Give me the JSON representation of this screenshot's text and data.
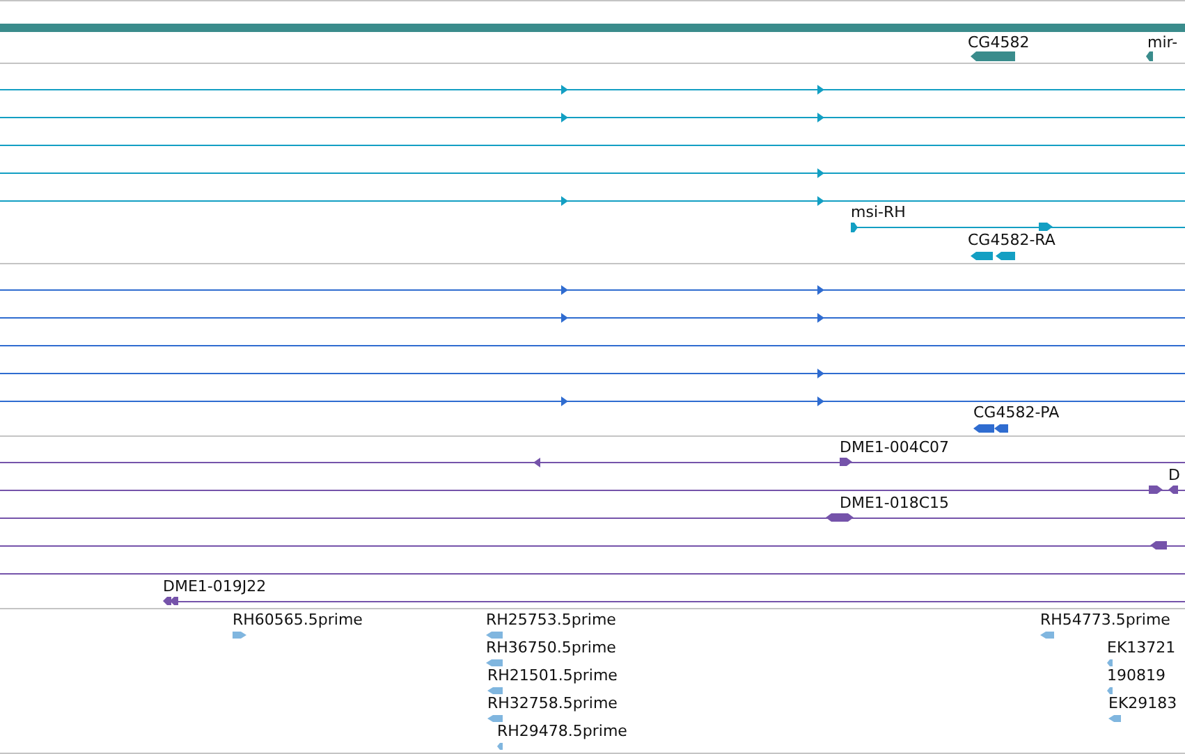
{
  "tracks": [
    {
      "kind": "genes",
      "color": "#3a8c8c",
      "features": [
        {
          "label": "CG4582",
          "forward": false,
          "reverse": true
        },
        {
          "label": "mir-",
          "forward": false,
          "reverse": true
        }
      ]
    },
    {
      "kind": "transcripts",
      "color": "#139fc3",
      "features": [
        {
          "label": "msi-RH",
          "forward": true,
          "reverse": false
        },
        {
          "label": "CG4582-RA",
          "forward": false,
          "reverse": true
        }
      ]
    },
    {
      "kind": "proteins",
      "color": "#2f6cd0",
      "features": [
        {
          "label": "CG4582-PA",
          "forward": false,
          "reverse": true
        }
      ]
    },
    {
      "kind": "clones",
      "color": "#7553aa",
      "features": [
        {
          "label": "DME1-004C07",
          "forward": true,
          "reverse": false
        },
        {
          "label": "D",
          "forward": false,
          "reverse": true
        },
        {
          "label": "DME1-018C15",
          "forward": true,
          "reverse": true
        },
        {
          "label": "DME1-019J22",
          "forward": false,
          "reverse": true
        }
      ]
    },
    {
      "kind": "ests",
      "color": "#80b6df",
      "features": [
        {
          "label": "RH60565.5prime",
          "forward": true,
          "reverse": false
        },
        {
          "label": "RH25753.5prime",
          "forward": false,
          "reverse": true
        },
        {
          "label": "RH36750.5prime",
          "forward": false,
          "reverse": true
        },
        {
          "label": "RH21501.5prime",
          "forward": false,
          "reverse": true
        },
        {
          "label": "RH32758.5prime",
          "forward": false,
          "reverse": true
        },
        {
          "label": "RH29478.5prime",
          "forward": false,
          "reverse": true
        },
        {
          "label": "RH54773.5prime",
          "forward": false,
          "reverse": true
        },
        {
          "label": "EK13721",
          "forward": false,
          "reverse": true
        },
        {
          "label": "190819",
          "forward": false,
          "reverse": true
        },
        {
          "label": "EK29183",
          "forward": false,
          "reverse": true
        }
      ]
    }
  ]
}
